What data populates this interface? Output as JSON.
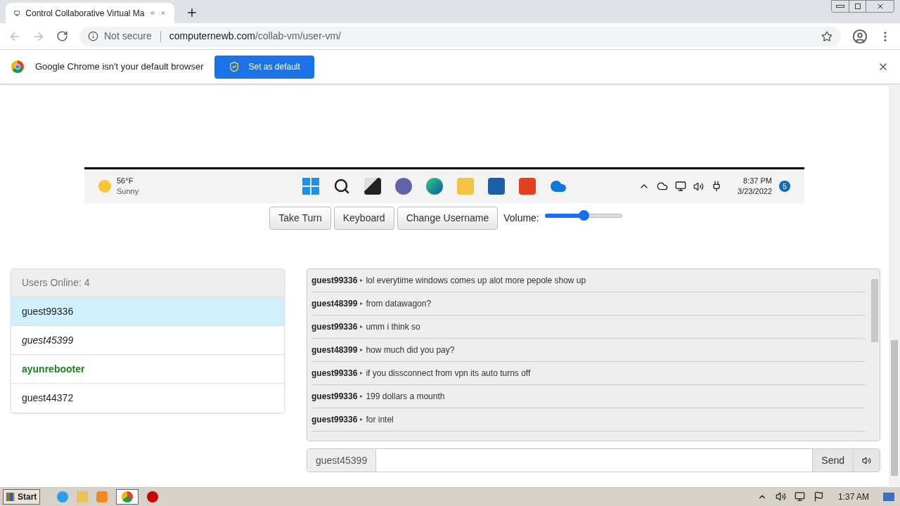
{
  "browser": {
    "tab": {
      "title": "Control Collaborative Virtual Ma",
      "selected": true
    },
    "security": "Not secure",
    "url_host": "computernewb.com",
    "url_path": "/collab-vm/user-vm/",
    "infobar": {
      "message": "Google Chrome isn't your default browser",
      "button": "Set as default"
    }
  },
  "vm_taskbar": {
    "weather": {
      "temp": "56°F",
      "condition": "Sunny"
    },
    "time": "8:37 PM",
    "date": "3/23/2022",
    "notifications": "5"
  },
  "controls": {
    "buttons": [
      "Take Turn",
      "Keyboard",
      "Change Username"
    ],
    "volume": {
      "label": "Volume:",
      "level": 0.5
    }
  },
  "users": {
    "title": "Users Online: 4",
    "items": [
      {
        "name": "guest99336",
        "kind": "normal",
        "selected": true
      },
      {
        "name": "guest45399",
        "kind": "self",
        "selected": false
      },
      {
        "name": "ayunrebooter",
        "kind": "admin",
        "selected": false
      },
      {
        "name": "guest44372",
        "kind": "normal",
        "selected": false
      }
    ]
  },
  "chat": {
    "messages": [
      {
        "user": "guest99336",
        "arrow": "▸",
        "text": "lol everytime windows comes up alot more pepole show up"
      },
      {
        "user": "guest48399",
        "arrow": "▸",
        "text": "from datawagon?"
      },
      {
        "user": "guest99336",
        "arrow": "▸",
        "text": "umm i think so"
      },
      {
        "user": "guest48399",
        "arrow": "▸",
        "text": "how much did you pay?"
      },
      {
        "user": "guest99336",
        "arrow": "▸",
        "text": "if you dissconnect from vpn its auto turns off"
      },
      {
        "user": "guest99336",
        "arrow": "▸",
        "text": "199 dollars a mounth"
      },
      {
        "user": "guest99336",
        "arrow": "▸",
        "text": "for intel"
      }
    ],
    "username": "guest45399",
    "send": "Send"
  },
  "os_taskbar": {
    "start": "Start",
    "time": "1:37 AM"
  }
}
